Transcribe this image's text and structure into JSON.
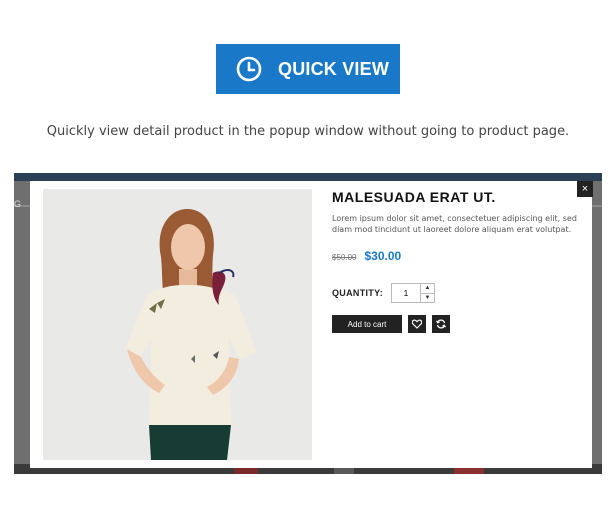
{
  "banner": {
    "label": "QUICK VIEW",
    "icon": "clock-icon",
    "color": "#1a78c8"
  },
  "tagline": "Quickly view detail product in the popup window without going to product page.",
  "modal": {
    "close_label": "×",
    "product": {
      "title": "MALESUADA ERAT UT.",
      "description": "Lorem ipsum dolor sit amet, consectetuer adipiscing elit, sed diam mod tincidunt ut laoreet dolore aliquam erat volutpat.",
      "old_price": "$50.00",
      "price": "$30.00",
      "quantity_label": "QUANTITY:",
      "quantity_value": "1",
      "add_to_cart_label": "Add to cart"
    }
  }
}
